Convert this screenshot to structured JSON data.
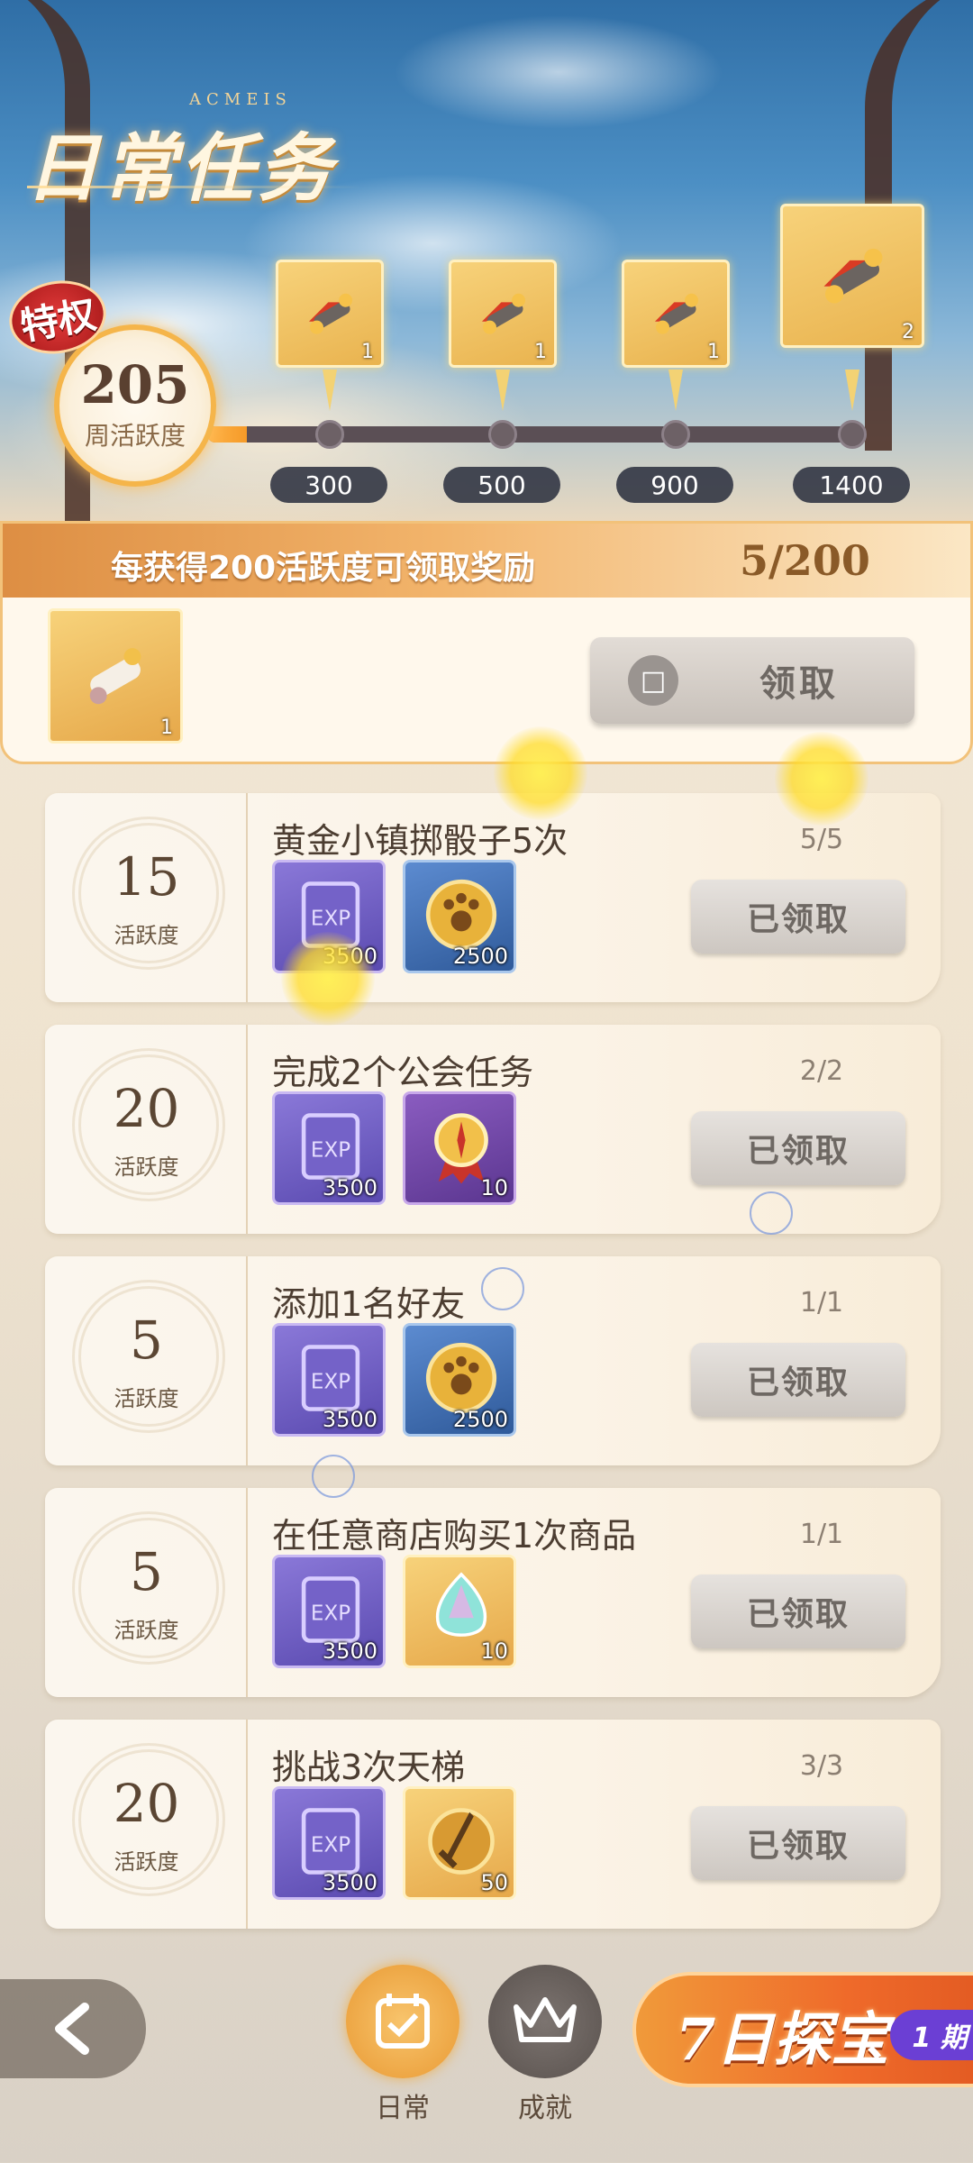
{
  "header": {
    "title": "日常任务",
    "title_sub": "ACMEIS",
    "privilege_badge": "特权",
    "weekly_activity_value": "205",
    "weekly_activity_label": "周活跃度",
    "progress_fraction": 0.205
  },
  "milestones": [
    {
      "threshold": "300",
      "count": "1",
      "icon": "scroll-chest-icon"
    },
    {
      "threshold": "500",
      "count": "1",
      "icon": "scroll-chest-icon"
    },
    {
      "threshold": "900",
      "count": "1",
      "icon": "scroll-chest-icon"
    },
    {
      "threshold": "1400",
      "count": "2",
      "icon": "scroll-chest-icon"
    }
  ],
  "reward": {
    "description": "每获得200活跃度可领取奖励",
    "progress": "5/200",
    "item_count": "1",
    "claim_label": "领取"
  },
  "tasks": [
    {
      "points": "15",
      "points_label": "活跃度",
      "title": "黄金小镇掷骰子5次",
      "progress": "5/5",
      "items": [
        {
          "type": "exp",
          "count": "3500"
        },
        {
          "type": "coin",
          "count": "2500"
        }
      ],
      "status": "已领取"
    },
    {
      "points": "20",
      "points_label": "活跃度",
      "title": "完成2个公会任务",
      "progress": "2/2",
      "items": [
        {
          "type": "exp",
          "count": "3500"
        },
        {
          "type": "medal",
          "count": "10"
        }
      ],
      "status": "已领取"
    },
    {
      "points": "5",
      "points_label": "活跃度",
      "title": "添加1名好友",
      "progress": "1/1",
      "items": [
        {
          "type": "exp",
          "count": "3500"
        },
        {
          "type": "coin",
          "count": "2500"
        }
      ],
      "status": "已领取"
    },
    {
      "points": "5",
      "points_label": "活跃度",
      "title": "在任意商店购买1次商品",
      "progress": "1/1",
      "items": [
        {
          "type": "exp",
          "count": "3500"
        },
        {
          "type": "gem",
          "count": "10"
        }
      ],
      "status": "已领取"
    },
    {
      "points": "20",
      "points_label": "活跃度",
      "title": "挑战3次天梯",
      "progress": "3/3",
      "items": [
        {
          "type": "exp",
          "count": "3500"
        },
        {
          "type": "sword",
          "count": "50"
        }
      ],
      "status": "已领取"
    }
  ],
  "nav": {
    "daily_label": "日常",
    "achievement_label": "成就",
    "event_title": "7日探宝",
    "event_period": "1 期"
  },
  "colors": {
    "accent_orange": "#f59a28",
    "claimed_gray": "#cdc7c1",
    "text_brown": "#4c3d31"
  }
}
